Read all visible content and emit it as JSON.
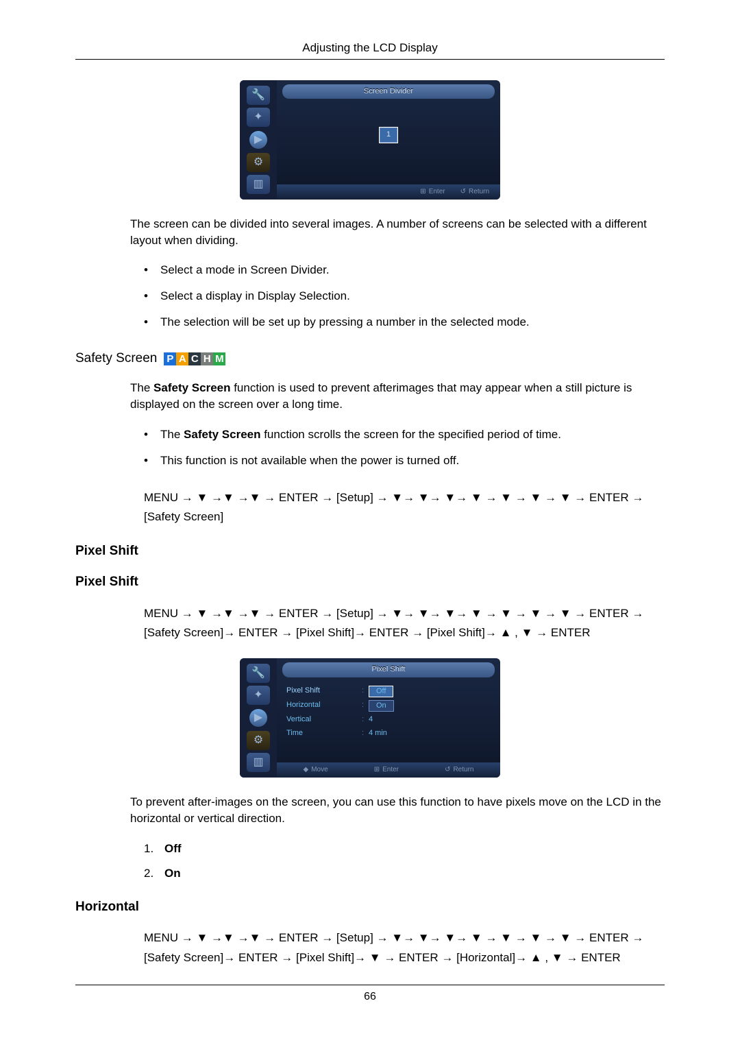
{
  "header": {
    "title": "Adjusting the LCD Display"
  },
  "osd1": {
    "title": "Screen Divider",
    "cell": "1",
    "footer": {
      "enter": "Enter",
      "return": "Return"
    }
  },
  "screen_divider": {
    "intro": "The screen can be divided into several images. A number of screens can be selected with a different layout when dividing.",
    "bullets": [
      "Select a mode in Screen Divider.",
      "Select a display in Display Selection.",
      "The selection will be set up by pressing a number in the selected mode."
    ]
  },
  "safety_screen": {
    "heading": "Safety Screen",
    "badges": [
      "P",
      "A",
      "C",
      "H",
      "M"
    ],
    "intro_pre": "The ",
    "intro_bold": "Safety Screen",
    "intro_post": " function is used to prevent afterimages that may appear when a still picture is displayed on the screen over a long time.",
    "bullets": [
      {
        "pre": "The ",
        "bold": "Safety Screen",
        "post": " function scrolls the screen for the specified period of time."
      },
      {
        "pre": "",
        "bold": "",
        "post": "This function is not available when the power is turned off."
      }
    ],
    "path": "MENU → ▼ →▼ →▼ → ENTER → [Setup] → ▼→ ▼→ ▼→ ▼ → ▼ → ▼ → ▼ → ENTER → [Safety Screen]"
  },
  "pixel_shift": {
    "heading1": "Pixel Shift",
    "heading2": "Pixel Shift",
    "path": "MENU → ▼ →▼ →▼ → ENTER → [Setup] → ▼→ ▼→ ▼→ ▼ → ▼ → ▼ → ▼ → ENTER → [Safety Screen]→ ENTER → [Pixel Shift]→ ENTER → [Pixel Shift]→ ▲ , ▼ → ENTER",
    "osd": {
      "title": "Pixel Shift",
      "rows": [
        {
          "label": "Pixel Shift",
          "value": "Off",
          "boxed": true,
          "hl": true
        },
        {
          "label": "Horizontal",
          "value": "On",
          "boxed": true,
          "hl": false
        },
        {
          "label": "Vertical",
          "value": "4",
          "boxed": false
        },
        {
          "label": "Time",
          "value": "4 min",
          "boxed": false
        }
      ],
      "footer": {
        "move": "Move",
        "enter": "Enter",
        "return": "Return"
      }
    },
    "intro": "To prevent after-images on the screen, you can use this function to have pixels move on the LCD in the horizontal or vertical direction.",
    "options": [
      {
        "num": "1.",
        "label": "Off"
      },
      {
        "num": "2.",
        "label": "On"
      }
    ]
  },
  "horizontal": {
    "heading": "Horizontal",
    "path": "MENU → ▼ →▼ →▼ → ENTER → [Setup] → ▼→ ▼→ ▼→ ▼ → ▼ → ▼ → ▼ → ENTER → [Safety Screen]→ ENTER → [Pixel Shift]→ ▼ → ENTER → [Horizontal]→ ▲ , ▼ → ENTER"
  },
  "page_number": "66"
}
